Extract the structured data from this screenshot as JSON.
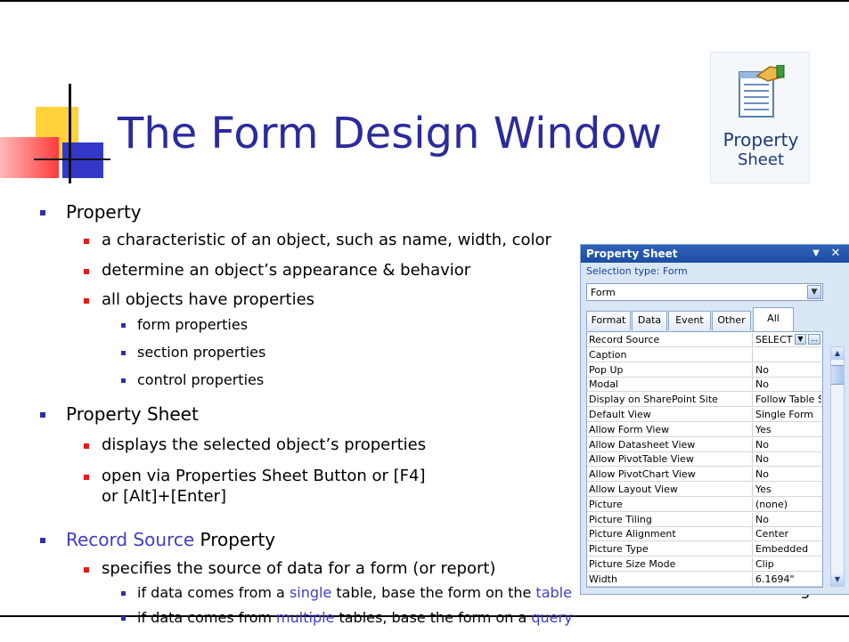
{
  "slide": {
    "title": "The Form Design Window",
    "page_number": "5"
  },
  "ribbon_button": {
    "line1": "Property",
    "line2": "Sheet",
    "icon": "property-sheet-icon"
  },
  "bullets": {
    "property": "Property",
    "property_subs": [
      "a characteristic of an object, such as name, width, color",
      "determine an object’s appearance & behavior",
      "all objects have properties"
    ],
    "property_types": [
      "form properties",
      "section properties",
      "control properties"
    ],
    "property_sheet": "Property Sheet",
    "property_sheet_subs": [
      "displays the selected object’s properties",
      "open via Properties Sheet Button or [F4]",
      "or [Alt]+[Enter]"
    ],
    "record_source_highlight": "Record Source",
    "record_source_rest": " Property",
    "record_source_sub": "specifies the source of data for a form (or report)",
    "rule1": {
      "a": "if data comes from a ",
      "b": "single",
      "c": " table, base the form on the ",
      "d": "table"
    },
    "rule2": {
      "a": "if data comes from ",
      "b": "multiple",
      "c": " tables, base the form on a ",
      "d": "query"
    }
  },
  "property_sheet": {
    "title": "Property Sheet",
    "selection_type": "Selection type:  Form",
    "selected_object": "Form",
    "tabs": [
      "Format",
      "Data",
      "Event",
      "Other",
      "All"
    ],
    "active_tab": "All",
    "rows": [
      {
        "name": "Record Source",
        "value": "SELECT ["
      },
      {
        "name": "Caption",
        "value": ""
      },
      {
        "name": "Pop Up",
        "value": "No"
      },
      {
        "name": "Modal",
        "value": "No"
      },
      {
        "name": "Display on SharePoint Site",
        "value": "Follow Table S"
      },
      {
        "name": "Default View",
        "value": "Single Form"
      },
      {
        "name": "Allow Form View",
        "value": "Yes"
      },
      {
        "name": "Allow Datasheet View",
        "value": "No"
      },
      {
        "name": "Allow PivotTable View",
        "value": "No"
      },
      {
        "name": "Allow PivotChart View",
        "value": "No"
      },
      {
        "name": "Allow Layout View",
        "value": "Yes"
      },
      {
        "name": "Picture",
        "value": "(none)"
      },
      {
        "name": "Picture Tiling",
        "value": "No"
      },
      {
        "name": "Picture Alignment",
        "value": "Center"
      },
      {
        "name": "Picture Type",
        "value": "Embedded"
      },
      {
        "name": "Picture Size Mode",
        "value": "Clip"
      },
      {
        "name": "Width",
        "value": "6.1694\""
      }
    ]
  }
}
